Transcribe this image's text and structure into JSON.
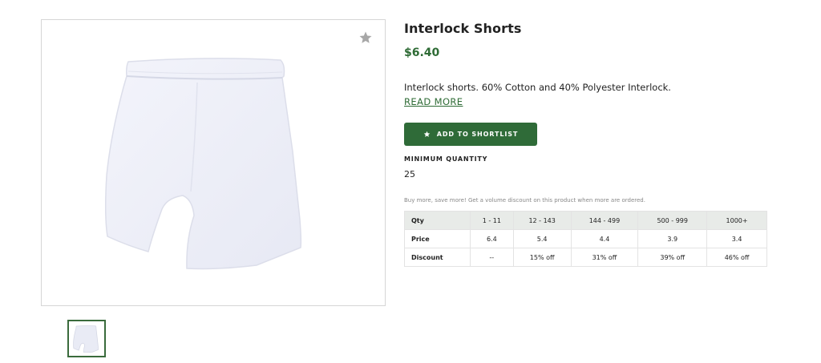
{
  "product": {
    "title": "Interlock Shorts",
    "price": "$6.40",
    "description": "Interlock shorts. 60% Cotton and 40% Polyester Interlock.",
    "read_more": "READ MORE",
    "shortlist_label": "ADD TO SHORTLIST",
    "min_qty_label": "MINIMUM QUANTITY",
    "min_qty_value": "25",
    "volume_note": "Buy more, save more! Get a volume discount on this product when more are ordered."
  },
  "gallery": {
    "main_image": "white-interlock-shorts",
    "thumbnail_count": 1,
    "star_icon": "star-icon"
  },
  "pricing_table": {
    "headers": [
      "Qty",
      "1 - 11",
      "12 - 143",
      "144 - 499",
      "500 - 999",
      "1000+"
    ],
    "rows": [
      [
        "Price",
        "6.4",
        "5.4",
        "4.4",
        "3.9",
        "3.4"
      ],
      [
        "Discount",
        "--",
        "15% off",
        "31% off",
        "39% off",
        "46% off"
      ]
    ]
  },
  "colors": {
    "accent_green": "#2f6b38",
    "price_green": "#2e6b35",
    "table_header_bg": "#e8ebe8"
  }
}
